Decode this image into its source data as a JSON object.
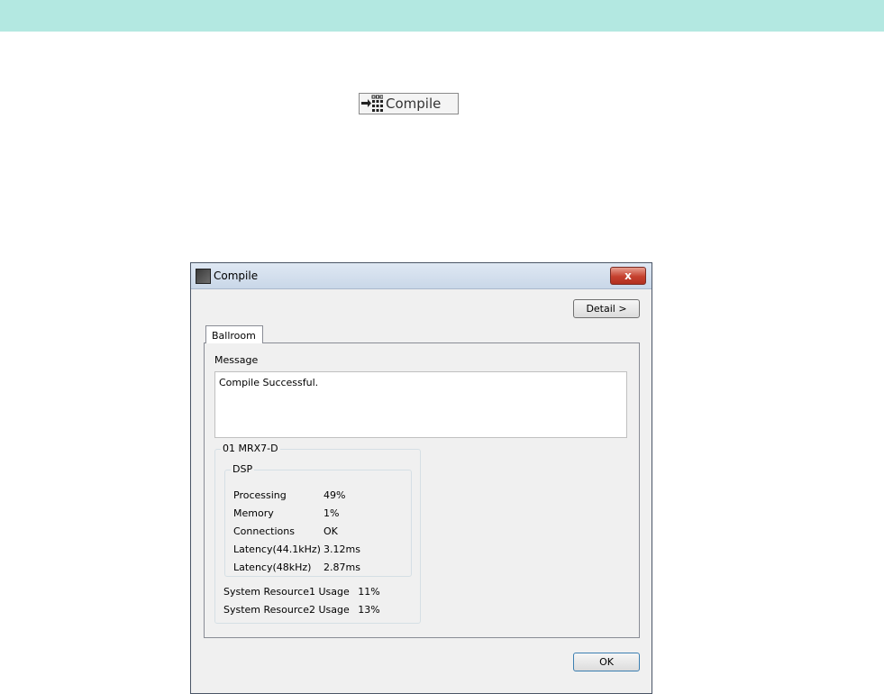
{
  "toolbar": {
    "compile_label": "Compile"
  },
  "dialog": {
    "title": "Compile",
    "close_label": "x",
    "detail_label": "Detail >",
    "tab_label": "Ballroom",
    "message_label": "Message",
    "message_text": "Compile Successful.",
    "device_name": "01 MRX7-D",
    "dsp_label": "DSP",
    "dsp_rows": [
      {
        "label": "Processing",
        "value": "49%"
      },
      {
        "label": "Memory",
        "value": "1%"
      },
      {
        "label": "Connections",
        "value": "OK"
      },
      {
        "label": "Latency(44.1kHz)",
        "value": "3.12ms"
      },
      {
        "label": "Latency(48kHz)",
        "value": "2.87ms"
      }
    ],
    "system_rows": [
      {
        "label": "System Resource1 Usage",
        "value": "11%"
      },
      {
        "label": "System Resource2 Usage",
        "value": "13%"
      }
    ],
    "ok_label": "OK"
  },
  "colors": {
    "top_band": "#b3e8e1",
    "close_button": "#c5402e",
    "ok_border": "#3c7fb1"
  },
  "icons": {
    "compile": "compile-grid-icon",
    "app": "app-icon",
    "close": "close-icon"
  }
}
